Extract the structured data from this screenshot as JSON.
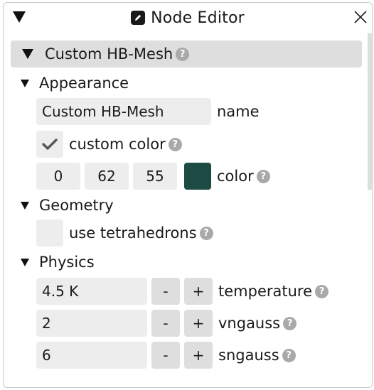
{
  "window": {
    "title": "Node Editor",
    "title_icon": "pencil-square-icon",
    "close_icon": "close-icon",
    "collapse_icon": "triangle-down-icon"
  },
  "node": {
    "title": "Custom HB-Mesh",
    "help": "?"
  },
  "sections": {
    "appearance": {
      "label": "Appearance",
      "name_value": "Custom HB-Mesh",
      "name_label": "name",
      "custom_color_label": "custom color",
      "custom_color_checked": true,
      "color_r": "0",
      "color_g": "62",
      "color_b": "55",
      "color_hex": "#1d4a43",
      "color_label": "color"
    },
    "geometry": {
      "label": "Geometry",
      "use_tetrahedrons_label": "use tetrahedrons",
      "use_tetrahedrons_checked": false
    },
    "physics": {
      "label": "Physics",
      "minus": "-",
      "plus": "+",
      "temperature_value": "4.5 K",
      "temperature_label": "temperature",
      "vngauss_value": "2",
      "vngauss_label": "vngauss",
      "sngauss_value": "6",
      "sngauss_label": "sngauss"
    }
  },
  "help_glyph": "?"
}
